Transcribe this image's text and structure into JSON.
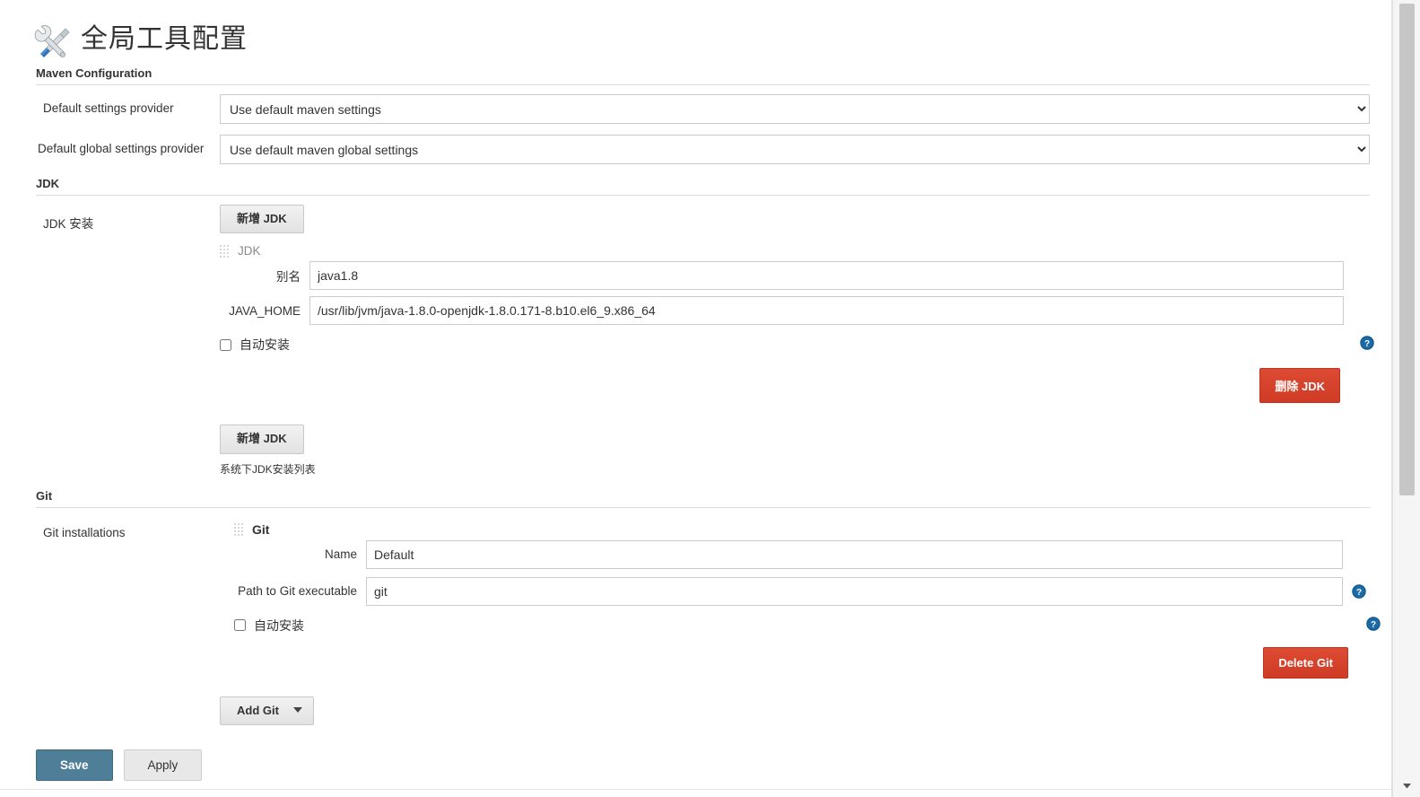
{
  "page": {
    "title": "全局工具配置",
    "title_icon": "wrench-screwdriver-icon"
  },
  "maven": {
    "section_title": "Maven Configuration",
    "rows": [
      {
        "label": "Default settings provider",
        "value": "Use default maven settings",
        "name": "default-settings-provider"
      },
      {
        "label": "Default global settings provider",
        "value": "Use default maven global settings",
        "name": "default-global-settings-provider"
      }
    ]
  },
  "jdk": {
    "section_title": "JDK",
    "row_label": "JDK 安装",
    "add_button_top": "新增 JDK",
    "add_button_bottom": "新增 JDK",
    "tool_name": "JDK",
    "fields": [
      {
        "label": "别名",
        "value": "java1.8",
        "name": "jdk-alias-input"
      },
      {
        "label": "JAVA_HOME",
        "value": "/usr/lib/jvm/java-1.8.0-openjdk-1.8.0.171-8.b10.el6_9.x86_64",
        "name": "java-home-input"
      }
    ],
    "auto_install_label": "自动安装",
    "auto_install_checked": false,
    "delete_button": "删除 JDK",
    "note": "系统下JDK安装列表"
  },
  "git": {
    "section_title": "Git",
    "row_label": "Git installations",
    "tool_name": "Git",
    "fields": [
      {
        "label": "Name",
        "value": "Default",
        "name": "git-name-input"
      },
      {
        "label": "Path to Git executable",
        "value": "git",
        "name": "git-path-input"
      }
    ],
    "auto_install_label": "自动安装",
    "auto_install_checked": false,
    "delete_button": "Delete Git",
    "add_button": "Add Git"
  },
  "footer": {
    "save_label": "Save",
    "apply_label": "Apply"
  },
  "icons": {
    "help": "help-icon",
    "grip": "drag-handle-icon",
    "caret": "chevron-down-icon"
  },
  "colors": {
    "save_button": "#4e7e98",
    "delete_button": "#d9422b",
    "help_icon": "#1a6aa8",
    "section_rule": "#dddddd"
  }
}
